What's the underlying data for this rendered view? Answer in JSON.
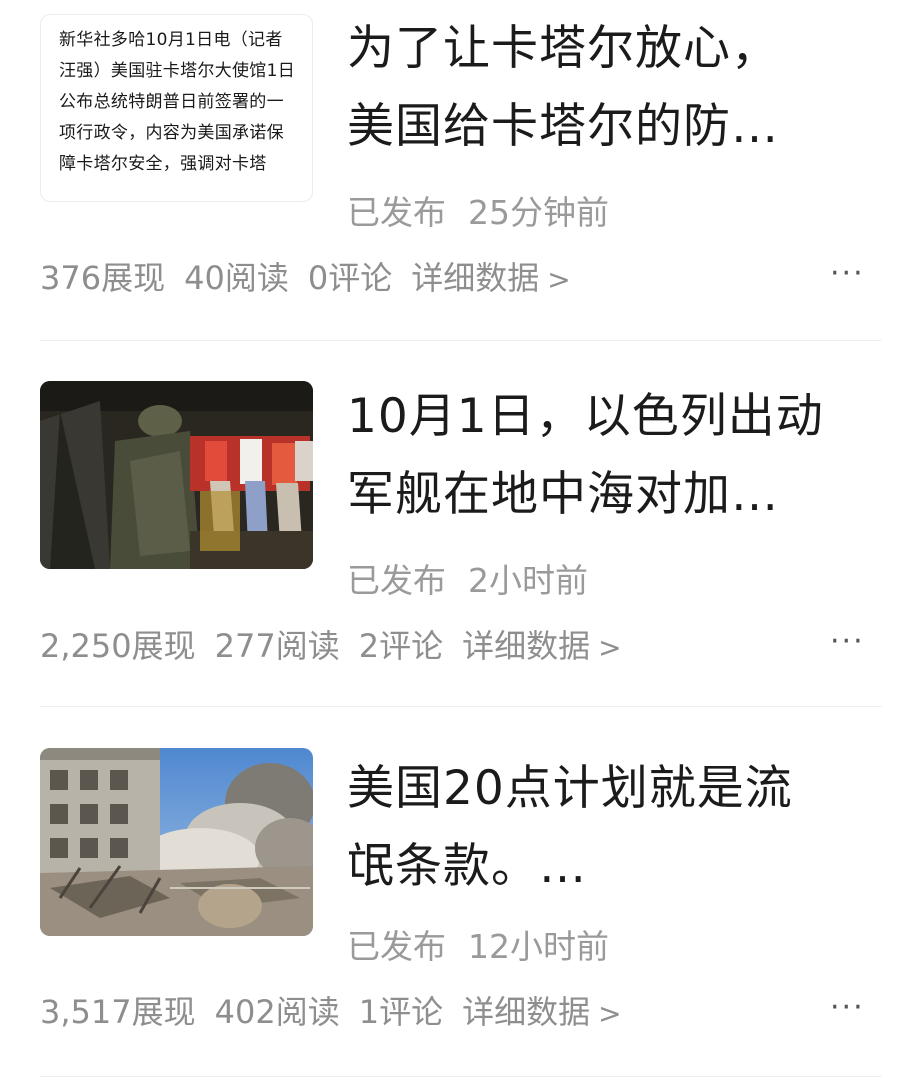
{
  "articles": [
    {
      "thumbnail_text": "新华社多哈10月1日电（记者汪强）美国驻卡塔尔大使馆1日公布总统特朗普日前签署的一项行政令，内容为美国承诺保障卡塔尔安全，强调对卡塔",
      "title_line1": "为了让卡塔尔放心，",
      "title_line2": "美国给卡塔尔的防…",
      "status": "已发布",
      "time": "25分钟前",
      "impressions": "376展现",
      "reads": "40阅读",
      "comments": "0评论",
      "detail_label": "详细数据",
      "more_icon": "···"
    },
    {
      "title_line1": "10月1日，以色列出动",
      "title_line2": "军舰在地中海对加…",
      "status": "已发布",
      "time": "2小时前",
      "impressions": "2,250展现",
      "reads": "277阅读",
      "comments": "2评论",
      "detail_label": "详细数据",
      "more_icon": "···"
    },
    {
      "title_line1": "美国20点计划就是流",
      "title_line2": "氓条款。…",
      "status": "已发布",
      "time": "12小时前",
      "impressions": "3,517展现",
      "reads": "402阅读",
      "comments": "1评论",
      "detail_label": "详细数据",
      "more_icon": "···"
    }
  ]
}
